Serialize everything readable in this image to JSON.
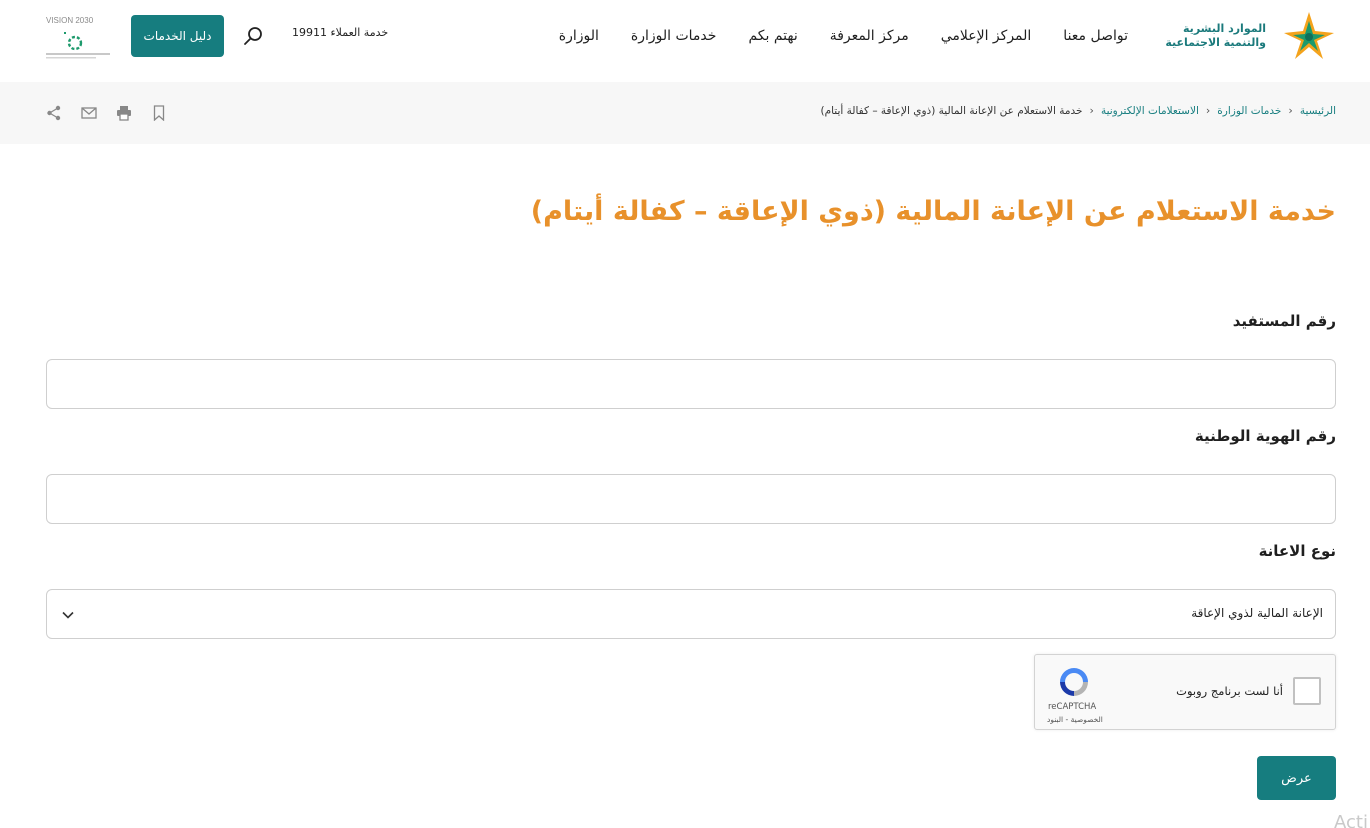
{
  "header": {
    "logo_text_line1": "الموارد البشرية",
    "logo_text_line2": "والتنمية الاجتماعية",
    "nav": [
      "الوزارة",
      "خدمات الوزارة",
      "نهتم بكم",
      "مركز المعرفة",
      "المركز الإعلامي",
      "تواصل معنا"
    ],
    "hotline": "خدمة العملاء 19911",
    "guide_button": "دليل الخدمات",
    "vision_text": "VISION 2030"
  },
  "breadcrumb": {
    "items": [
      "الرئيسية",
      "خدمات الوزارة",
      "الاستعلامات الإلكترونية"
    ],
    "current": "خدمة الاستعلام عن الإعانة المالية (ذوي الإعاقة – كفالة أيتام)"
  },
  "main": {
    "title": "خدمة الاستعلام عن الإعانة المالية (ذوي الإعاقة – كفالة أيتام)",
    "beneficiary_label": "رقم المستفيد",
    "beneficiary_value": "",
    "national_id_label": "رقم الهوية الوطنية",
    "national_id_value": "",
    "aid_type_label": "نوع الاعانة",
    "aid_type_selected": "الإعانة المالية لذوي الإعاقة",
    "captcha_label": "أنا لست برنامج روبوت",
    "captcha_brand": "reCAPTCHA",
    "captcha_links": "الخصوصية - البنود",
    "submit_label": "عرض"
  },
  "colors": {
    "brand_teal": "#167d7f",
    "title_orange": "#e8912b"
  },
  "watermark": "Acti"
}
